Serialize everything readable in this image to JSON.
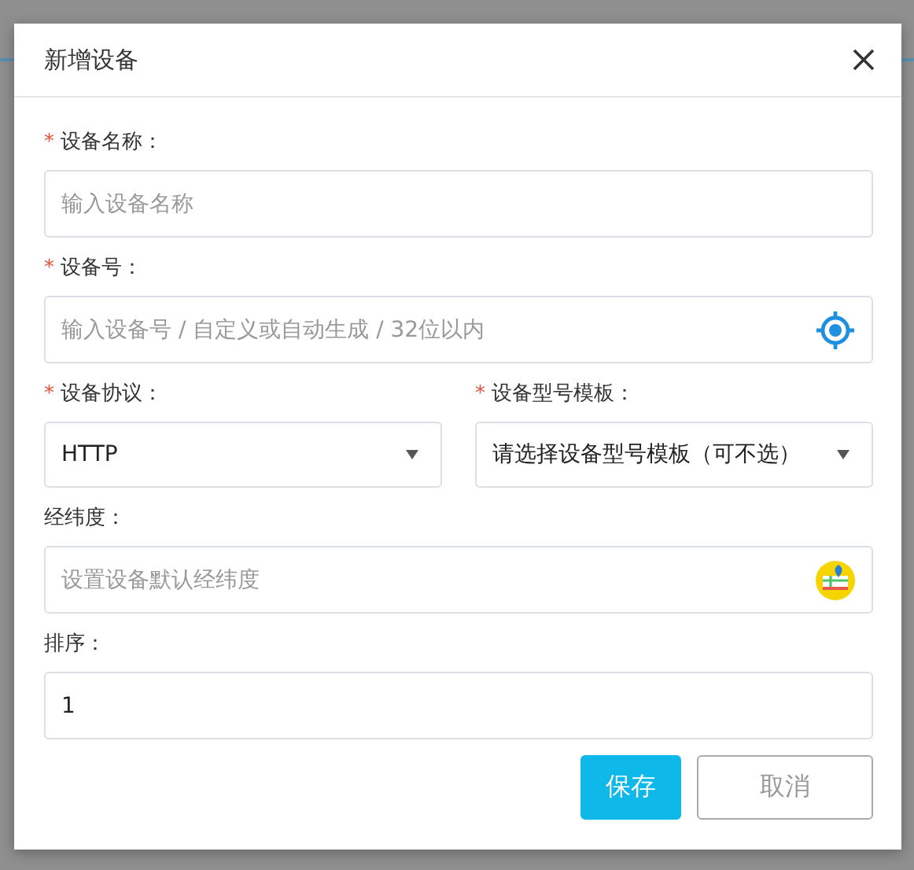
{
  "dialog": {
    "title": "新增设备"
  },
  "rows": [
    {
      "fields": [
        {
          "label": "设备名称：",
          "marker": "*",
          "kind": "text",
          "placeholder": "输入设备名称"
        }
      ]
    },
    {
      "fields": [
        {
          "label": "设备号：",
          "marker": "*",
          "kind": "locate-text",
          "placeholder": "输入设备号 / 自定义或自动生成 / 32位以内"
        }
      ]
    },
    {
      "fields": [
        {
          "label": "设备协议：",
          "marker": "*",
          "kind": "select",
          "value": "HTTP"
        },
        {
          "label": "设备型号模板：",
          "marker": "*",
          "kind": "select",
          "value": "请选择设备型号模板（可不选）"
        }
      ]
    },
    {
      "fields": [
        {
          "label": "经纬度：",
          "kind": "map-text",
          "placeholder": "设置设备默认经纬度"
        }
      ]
    },
    {
      "fields": [
        {
          "label": "排序：",
          "kind": "text",
          "value": "1"
        }
      ]
    }
  ],
  "buttons": [
    {
      "label": "保存",
      "kind": "primary"
    },
    {
      "label": "取消",
      "kind": "default"
    }
  ]
}
